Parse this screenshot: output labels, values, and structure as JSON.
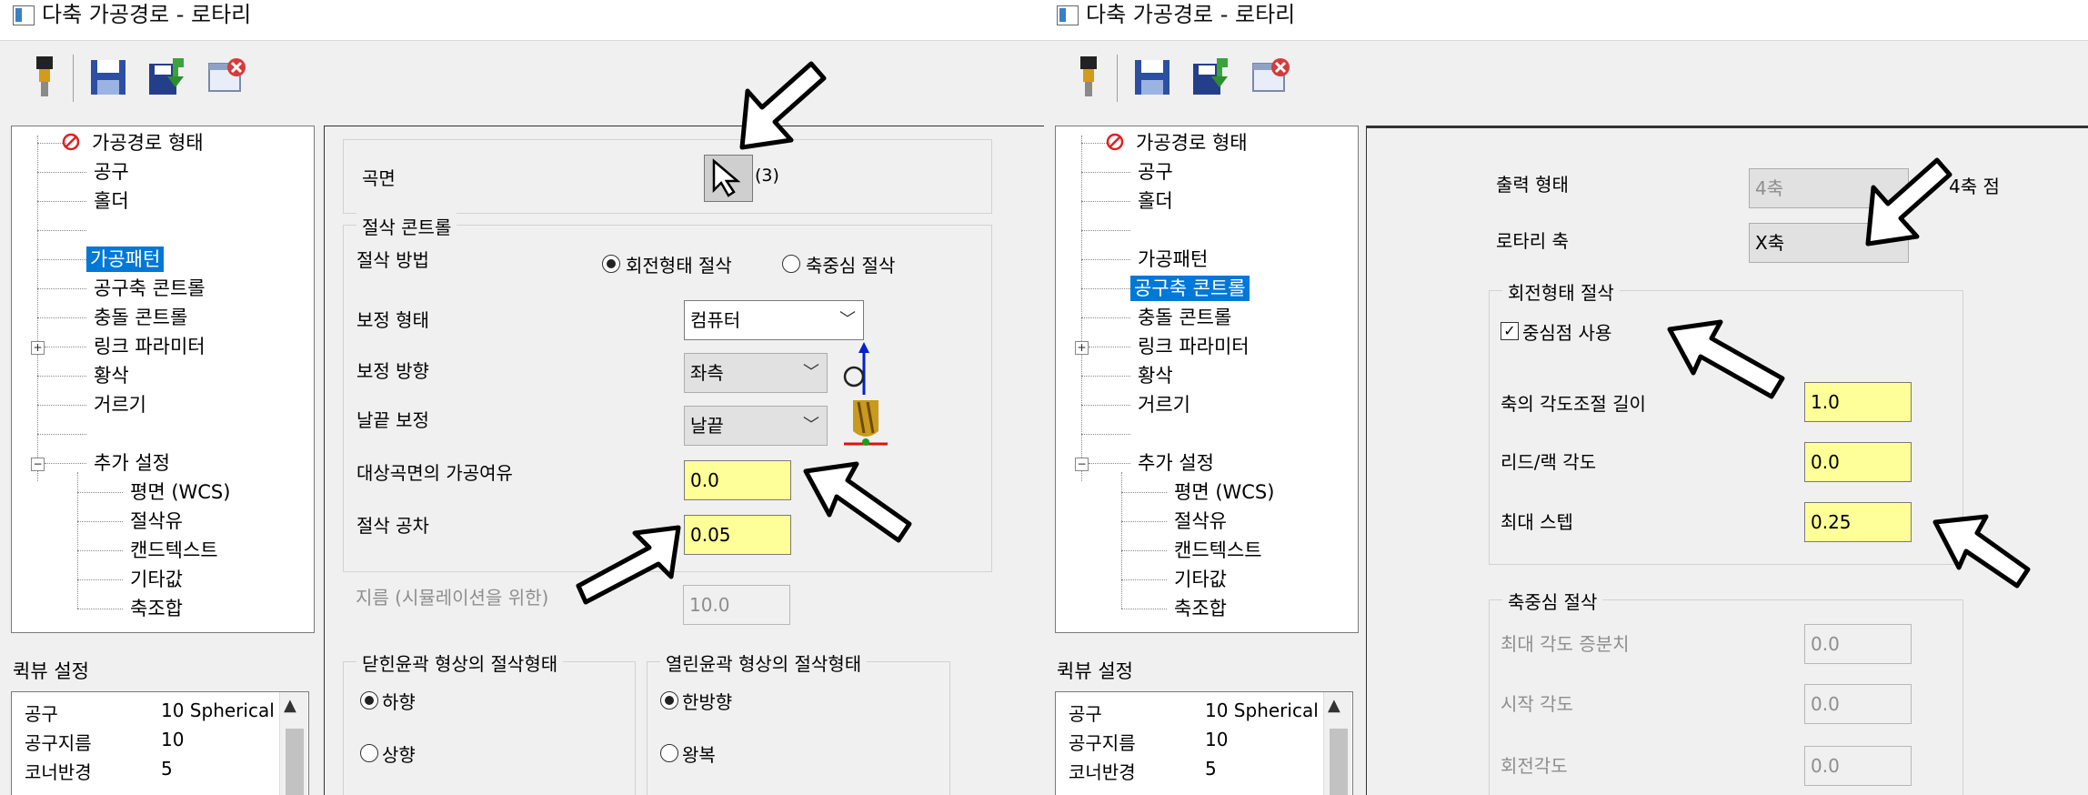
{
  "window_title": "다축 가공경로 - 로타리",
  "tree": {
    "items": [
      "가공경로 형태",
      "공구",
      "홀더",
      "",
      "가공패턴",
      "공구축 콘트롤",
      "충돌 콘트롤",
      "링크 파라미터",
      "황삭",
      "거르기",
      "",
      "추가 설정"
    ],
    "sub_items": [
      "평면 (WCS)",
      "절삭유",
      "캔드텍스트",
      "기타값",
      "축조합"
    ]
  },
  "quick": {
    "title": "퀵뷰 설정",
    "rows": [
      {
        "label": "공구",
        "value": "10 Spherical ,"
      },
      {
        "label": "공구지름",
        "value": "10"
      },
      {
        "label": "코너반경",
        "value": "5"
      }
    ]
  },
  "left": {
    "surface_label": "곡면",
    "surface_count": "(3)",
    "cut_control": "절삭 콘트롤",
    "cut_method_label": "절삭 방법",
    "cut_method_opt1": "회전형태 절삭",
    "cut_method_opt2": "축중심 절삭",
    "comp_type_label": "보정 형태",
    "comp_type_value": "컴퓨터",
    "comp_dir_label": "보정 방향",
    "comp_dir_value": "좌측",
    "tip_comp_label": "날끝 보정",
    "tip_comp_value": "날끝",
    "stock_label": "대상곡면의 가공여유",
    "stock_value": "0.0",
    "tol_label": "절삭 공차",
    "tol_value": "0.05",
    "dia_label": "지름 (시뮬레이션을 위한)",
    "dia_value": "10.0",
    "closed_group": "닫힌윤곽 형상의 절삭형태",
    "closed_opt1": "하향",
    "closed_opt2": "상향",
    "open_group": "열린윤곽 형상의 절삭형태",
    "open_opt1": "한방향",
    "open_opt2": "왕복"
  },
  "right": {
    "output_label": "출력 형태",
    "output_value": "4축",
    "output_suffix": "4축 점",
    "rotary_label": "로타리 축",
    "rotary_value": "X축",
    "rot_group": "회전형태 절삭",
    "center_check": "중심점 사용",
    "axis_angle_label": "축의 각도조절 길이",
    "axis_angle_value": "1.0",
    "lead_label": "리드/랙 각도",
    "lead_value": "0.0",
    "step_label": "최대 스텝",
    "step_value": "0.25",
    "axial_group": "축중심 절삭",
    "max_inc_label": "최대 각도 증분치",
    "max_inc_value": "0.0",
    "start_label": "시작 각도",
    "start_value": "0.0",
    "rot_angle_label": "회전각도",
    "rot_angle_value": "0.0"
  }
}
